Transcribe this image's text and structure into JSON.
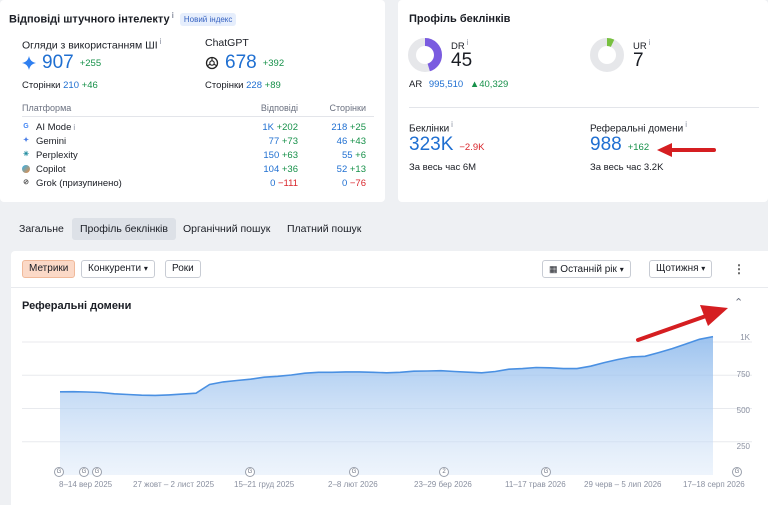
{
  "ai_card": {
    "title": "Відповіді штучного інтелекту",
    "badge": "Новий індекс",
    "ai_overview": {
      "label": "Огляди з використанням ШІ",
      "value": "907",
      "delta": "+255",
      "pages_label": "Сторінки",
      "pages_value": "210",
      "pages_delta": "+46"
    },
    "chatgpt": {
      "label": "ChatGPT",
      "value": "678",
      "delta": "+392",
      "pages_label": "Сторінки",
      "pages_value": "228",
      "pages_delta": "+89"
    },
    "table": {
      "headers": [
        "Платформа",
        "Відповіді",
        "Сторінки"
      ],
      "rows": [
        {
          "name": "AI Mode",
          "icon": "google-icon",
          "answers": "1K",
          "answers_delta": "+202",
          "pages": "218",
          "pages_delta": "+25"
        },
        {
          "name": "Gemini",
          "icon": "gemini-icon",
          "answers": "77",
          "answers_delta": "+73",
          "pages": "46",
          "pages_delta": "+43"
        },
        {
          "name": "Perplexity",
          "icon": "perplexity-icon",
          "answers": "150",
          "answers_delta": "+63",
          "pages": "55",
          "pages_delta": "+6"
        },
        {
          "name": "Copilot",
          "icon": "copilot-icon",
          "answers": "104",
          "answers_delta": "+36",
          "pages": "52",
          "pages_delta": "+13"
        },
        {
          "name": "Grok (призупинено)",
          "icon": "grok-icon",
          "answers": "0",
          "answers_delta": "−111",
          "pages": "0",
          "pages_delta": "−76"
        }
      ]
    }
  },
  "backlink_card": {
    "title": "Профіль беклінків",
    "dr_label": "DR",
    "dr_value": "45",
    "ur_label": "UR",
    "ur_value": "7",
    "ar_label": "AR",
    "ar_value": "995,510",
    "ar_delta": "40,329",
    "backlinks_label": "Беклінки",
    "backlinks_value": "323K",
    "backlinks_delta": "−2.9K",
    "backlinks_alltime": "За весь час",
    "backlinks_alltime_value": "6M",
    "refdomains_label": "Реферальні домени",
    "refdomains_value": "988",
    "refdomains_delta": "+162",
    "refdomains_alltime": "За весь час",
    "refdomains_alltime_value": "3.2K",
    "dr_fraction": 0.45,
    "ur_fraction": 0.07
  },
  "tabs": [
    "Загальне",
    "Профіль беклінків",
    "Органічний пошук",
    "Платний пошук"
  ],
  "toolbar": {
    "segments": [
      "Метрики",
      "Конкуренти",
      "Роки"
    ],
    "period": "Останній рік",
    "frequency": "Щотижня"
  },
  "chart_section_title": "Реферальні домени",
  "chart_data": {
    "type": "area",
    "title": "Реферальні домени",
    "y_ticks": [
      "1K",
      "750",
      "500",
      "250"
    ],
    "ylim": [
      0,
      1150
    ],
    "x_tick_labels": [
      "8–14 вер 2025",
      "27 жовт – 2 лист 2025",
      "15–21 груд 2025",
      "2–8 лют 2026",
      "23–29 бер 2026",
      "11–17 трав 2026",
      "29 черв – 5 лип 2026",
      "17–18 серп 2026"
    ],
    "annotation_markers": [
      "G",
      "G",
      "G",
      "G",
      "G",
      "2",
      "G",
      "G"
    ],
    "values": [
      625,
      626,
      624,
      620,
      610,
      605,
      600,
      598,
      602,
      608,
      615,
      680,
      700,
      710,
      720,
      735,
      742,
      752,
      765,
      772,
      772,
      775,
      775,
      772,
      768,
      772,
      780,
      782,
      784,
      778,
      773,
      768,
      778,
      795,
      800,
      808,
      806,
      800,
      800,
      818,
      845,
      868,
      888,
      892,
      920,
      950,
      985,
      1020,
      1040
    ],
    "color": "#4a90e2",
    "grid": true
  },
  "colors": {
    "accent": "#1f6fd1",
    "positive": "#17914a",
    "negative": "#d9262c",
    "arrow": "#d51e21",
    "dr_ring": "#7a5be0",
    "ur_ring": "#78c040"
  }
}
